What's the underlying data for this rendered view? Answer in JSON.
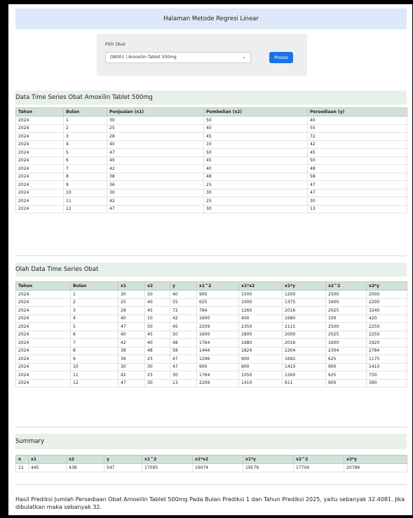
{
  "header": {
    "title": "Halaman Metode Regresi Linear"
  },
  "selector": {
    "label": "Pilih Obat",
    "selected": "OB001 | Amoxilin Tablet 500mg",
    "button": "Proses"
  },
  "timeseries": {
    "title": "Data Time Series Obat Amoxilin Tablet 500mg",
    "headers": [
      "Tahun",
      "Bulan",
      "Penjualan (x1)",
      "Pembelian (x2)",
      "Persediaan (y)"
    ],
    "rows": [
      [
        "2024",
        "1",
        "30",
        "50",
        "40"
      ],
      [
        "2024",
        "2",
        "25",
        "40",
        "55"
      ],
      [
        "2024",
        "3",
        "28",
        "45",
        "72"
      ],
      [
        "2024",
        "4",
        "40",
        "10",
        "42"
      ],
      [
        "2024",
        "5",
        "47",
        "50",
        "45"
      ],
      [
        "2024",
        "6",
        "40",
        "45",
        "50"
      ],
      [
        "2024",
        "7",
        "42",
        "40",
        "48"
      ],
      [
        "2024",
        "8",
        "38",
        "48",
        "58"
      ],
      [
        "2024",
        "9",
        "36",
        "25",
        "47"
      ],
      [
        "2024",
        "10",
        "30",
        "30",
        "47"
      ],
      [
        "2024",
        "11",
        "42",
        "25",
        "30"
      ],
      [
        "2024",
        "12",
        "47",
        "30",
        "13"
      ]
    ]
  },
  "olah": {
    "title": "Olah Data Time Series Obat",
    "headers": [
      "Tahun",
      "Bulan",
      "x1",
      "x2",
      "y",
      "x1^2",
      "x1*x2",
      "x1*y",
      "x2^2",
      "x2*y"
    ],
    "rows": [
      [
        "2024",
        "1",
        "30",
        "50",
        "40",
        "900",
        "1500",
        "1200",
        "2500",
        "2000"
      ],
      [
        "2024",
        "2",
        "25",
        "40",
        "55",
        "625",
        "1000",
        "1375",
        "1600",
        "2200"
      ],
      [
        "2024",
        "3",
        "28",
        "45",
        "72",
        "784",
        "1260",
        "2016",
        "2025",
        "3240"
      ],
      [
        "2024",
        "4",
        "40",
        "10",
        "42",
        "1600",
        "400",
        "1680",
        "100",
        "420"
      ],
      [
        "2024",
        "5",
        "47",
        "50",
        "45",
        "2209",
        "2350",
        "2115",
        "2500",
        "2250"
      ],
      [
        "2024",
        "6",
        "40",
        "45",
        "50",
        "1600",
        "1800",
        "2000",
        "2025",
        "2250"
      ],
      [
        "2024",
        "7",
        "42",
        "40",
        "48",
        "1764",
        "1680",
        "2016",
        "1600",
        "1920"
      ],
      [
        "2024",
        "8",
        "38",
        "48",
        "58",
        "1444",
        "1824",
        "2204",
        "2304",
        "2784"
      ],
      [
        "2024",
        "9",
        "36",
        "25",
        "47",
        "1296",
        "900",
        "1692",
        "625",
        "1175"
      ],
      [
        "2024",
        "10",
        "30",
        "30",
        "47",
        "900",
        "900",
        "1410",
        "900",
        "1410"
      ],
      [
        "2024",
        "11",
        "42",
        "25",
        "30",
        "1764",
        "1050",
        "1260",
        "625",
        "750"
      ],
      [
        "2024",
        "12",
        "47",
        "30",
        "13",
        "2209",
        "1410",
        "611",
        "900",
        "390"
      ]
    ]
  },
  "summary": {
    "title": "Summary",
    "headers": [
      "n",
      "x1",
      "x2",
      "y",
      "x1^2",
      "x1*x2",
      "x1*y",
      "x2^2",
      "x2*y"
    ],
    "rows": [
      [
        "12",
        "445",
        "438",
        "547",
        "17095",
        "16074",
        "19579",
        "17704",
        "20789"
      ]
    ]
  },
  "result": {
    "text": "Hasil Prediksi Jumlah Persediaan Obat Amoxilin Tablet 500mg Pada Bulan Prediksi 1 dan Tahun Prediksi 2025, yaitu sebanyak 32.4081. Jika dibulatkan maka sebanyak 32."
  }
}
